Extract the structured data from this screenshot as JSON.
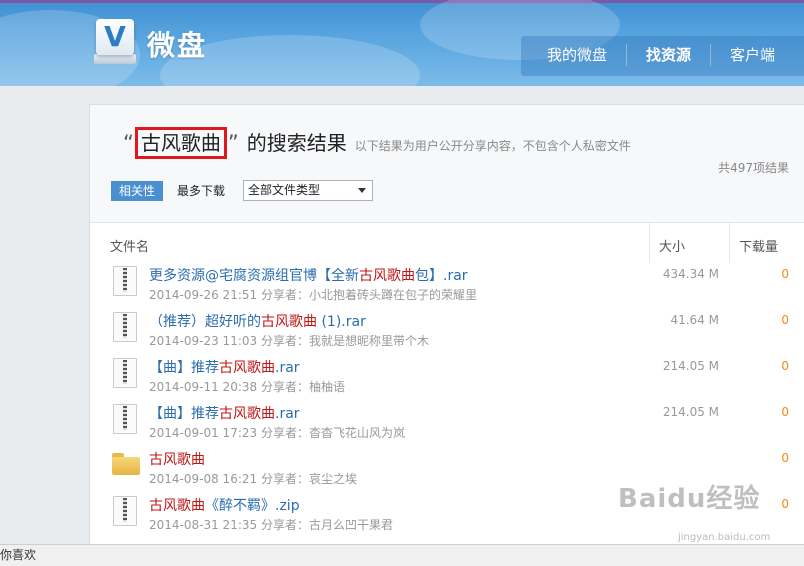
{
  "header": {
    "logo_letter": "V",
    "logo_text": "微盘",
    "nav": [
      "我的微盘",
      "找资源",
      "客户端"
    ]
  },
  "search": {
    "quote_open": "“",
    "keyword": "古风歌曲",
    "quote_close": "”",
    "title_rest": "的搜索结果",
    "note": "以下结果为用户公开分享内容，不包含个人私密文件",
    "total": "共497项结果",
    "sort_relevance": "相关性",
    "sort_most_download": "最多下载",
    "filetype_selected": "全部文件类型"
  },
  "columns": {
    "name": "文件名",
    "size": "大小",
    "downloads": "下载量"
  },
  "sharer_label": "分享者：",
  "files": [
    {
      "name_pre": "更多资源@宅腐资源组官博【全新",
      "name_hl": "古风歌曲",
      "name_post": "包】.rar",
      "date": "2014-09-26 21:51",
      "sharer": "小北抱着砖头蹲在包子的荣耀里",
      "size": "434.34 M",
      "downloads": "0",
      "type": "archive"
    },
    {
      "name_pre": "（推荐）超好听的",
      "name_hl": "古风歌曲",
      "name_post": " (1).rar",
      "date": "2014-09-23 11:03",
      "sharer": "我就是想昵称里带个木",
      "size": "41.64 M",
      "downloads": "0",
      "type": "archive"
    },
    {
      "name_pre": "【曲】推荐",
      "name_hl": "古风歌曲",
      "name_post": ".rar",
      "date": "2014-09-11 20:38",
      "sharer": "柚柚语",
      "size": "214.05 M",
      "downloads": "0",
      "type": "archive"
    },
    {
      "name_pre": "【曲】推荐",
      "name_hl": "古风歌曲",
      "name_post": ".rar",
      "date": "2014-09-01 17:23",
      "sharer": "杳杳飞花山风为岚",
      "size": "214.05 M",
      "downloads": "0",
      "type": "archive"
    },
    {
      "name_pre": "",
      "name_hl": "古风歌曲",
      "name_post": "",
      "date": "2014-09-08 16:21",
      "sharer": "哀尘之埃",
      "size": "",
      "downloads": "0",
      "type": "folder"
    },
    {
      "name_pre": "",
      "name_hl": "古风歌曲",
      "name_post": "《醉不羁》.zip",
      "date": "2014-08-31 21:35",
      "sharer": "古月么凹干果君",
      "size": "",
      "downloads": "0",
      "type": "archive"
    }
  ],
  "statusbar": {
    "text": "你喜欢"
  },
  "watermark": {
    "text": "Baidu经验",
    "sub": "jingyan.baidu.com"
  }
}
